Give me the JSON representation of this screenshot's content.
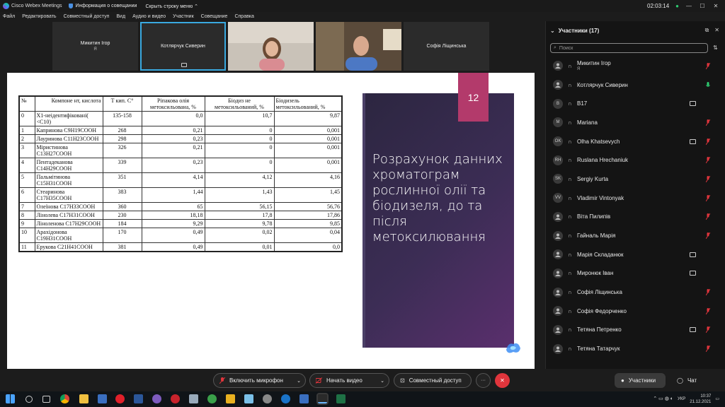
{
  "titlebar": {
    "app": "Cisco Webex Meetings",
    "info": "Информация о совещании",
    "hide_menu": "Скрыть строку меню",
    "timer": "02:03:14"
  },
  "menu": [
    "Файл",
    "Редактировать",
    "Совместный доступ",
    "Вид",
    "Аудио и видео",
    "Участник",
    "Совещание",
    "Справка"
  ],
  "tiles": [
    {
      "name": "Микитин Ігор",
      "sub": "Я"
    },
    {
      "name": "Котлярчук Сиверин"
    },
    {
      "name": "Софія Ліщинська"
    }
  ],
  "slide": {
    "number": "12",
    "title": "Розрахунок данних хроматограм рослинної олії та біодизеля, до та після метоксилювання",
    "headers": [
      "№",
      "Компоне нт, кислота",
      "Т кип. С°",
      "Ріпакова олія метоксильована, %",
      "Біодиз не метоксильований, %",
      "Біодизель метоксильований, %"
    ],
    "rows": [
      [
        "0",
        "Х1-неідентифіковані( <C10)",
        "135-158",
        "0,0",
        "10,7",
        "9,87"
      ],
      [
        "1",
        "Капринова C9H19COOH",
        "268",
        "0,21",
        "0",
        "0,001"
      ],
      [
        "2",
        "Лауринова C11H23COOH",
        "298",
        "0,23",
        "0",
        "0,001"
      ],
      [
        "3",
        "Міристинова C13H27COOH",
        "326",
        "0,21",
        "0",
        "0,001"
      ],
      [
        "4",
        "Пентадеканова C14H29COOH",
        "339",
        "0,23",
        "0",
        "0,001"
      ],
      [
        "5",
        "Пальмітинова C15H31COOH",
        "351",
        "4,14",
        "4,12",
        "4,16"
      ],
      [
        "6",
        "Стеаринова C17H35COOH",
        "383",
        "1,44",
        "1,43",
        "1,45"
      ],
      [
        "7",
        "Олеїнова C17H33COOH",
        "360",
        "65",
        "56,15",
        "56,76"
      ],
      [
        "8",
        "Лінолева C17H31COOH",
        "230",
        "18,18",
        "17,8",
        "17,86"
      ],
      [
        "9",
        "Ліноленова C17H29COOH",
        "184",
        "9,29",
        "9,78",
        "9,85"
      ],
      [
        "10",
        "Арахідонова C19H31COOH",
        "170",
        "0,49",
        "0,02",
        "0,04"
      ],
      [
        "11",
        "Ерукова C21H41COOH",
        "381",
        "0,49",
        "0,01",
        "0,0"
      ]
    ]
  },
  "panel": {
    "title": "Участники (17)",
    "search_placeholder": "Поиск",
    "participants": [
      {
        "name": "Микитин Ігор",
        "sub": "Я",
        "initials": "",
        "mic": "muted",
        "video": false
      },
      {
        "name": "Котлярчук Сиверин",
        "initials": "",
        "mic": "on",
        "video": false
      },
      {
        "name": "B17",
        "initials": "B",
        "mic": "none",
        "video": true
      },
      {
        "name": "Mariana",
        "initials": "M",
        "mic": "muted",
        "video": false
      },
      {
        "name": "Olha Khatsevych",
        "initials": "OK",
        "mic": "muted",
        "video": true
      },
      {
        "name": "Ruslana Hrechaniuk",
        "initials": "RH",
        "mic": "muted",
        "video": false
      },
      {
        "name": "Sergiy Kurta",
        "initials": "SK",
        "mic": "muted",
        "video": false
      },
      {
        "name": "Vladimir Vintonyak",
        "initials": "VV",
        "mic": "muted",
        "video": false
      },
      {
        "name": "Віта Пилипів",
        "initials": "",
        "mic": "muted",
        "video": false
      },
      {
        "name": "Гайналь Марія",
        "initials": "",
        "mic": "muted",
        "video": false
      },
      {
        "name": "Марія Складанюк",
        "initials": "",
        "mic": "none",
        "video": true
      },
      {
        "name": "Миронюк Іван",
        "initials": "",
        "mic": "none",
        "video": true
      },
      {
        "name": "Софія Ліщинська",
        "initials": "",
        "mic": "muted",
        "video": false
      },
      {
        "name": "Софія Федорченко",
        "initials": "",
        "mic": "muted",
        "video": false
      },
      {
        "name": "Тетяна Петренко",
        "initials": "",
        "mic": "muted",
        "video": true
      },
      {
        "name": "Тетяна Татарчук",
        "initials": "",
        "mic": "muted",
        "video": false
      }
    ]
  },
  "toolbar": {
    "mic": "Включить микрофон",
    "video": "Начать видео",
    "share": "Совместный доступ",
    "participants": "Участники",
    "chat": "Чат",
    "more": "···",
    "leave": "✕"
  },
  "taskbar": {
    "lang": "УКР",
    "time": "10:37",
    "date": "21.12.2021"
  },
  "colors": {
    "accent": "#3aa9e0",
    "slide_num_bg": "#b33a6b",
    "leave": "#e0353c",
    "muted_mic": "#e0353c",
    "active_mic": "#2ecc71"
  }
}
